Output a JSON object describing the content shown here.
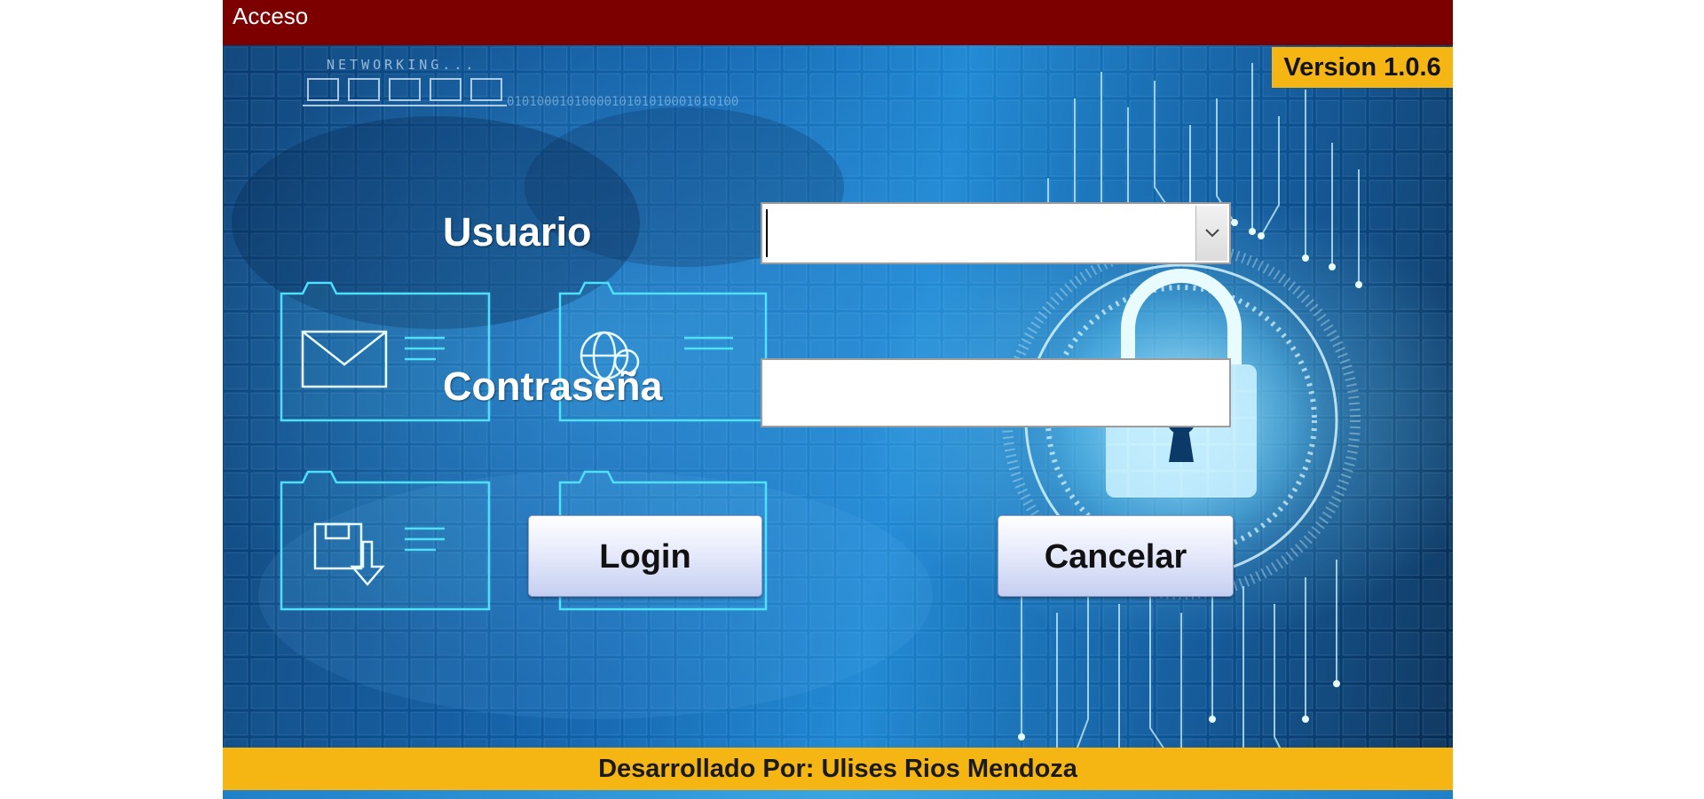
{
  "window": {
    "title": "Acceso"
  },
  "background": {
    "networking_text": "NETWORKING...",
    "binary_text": "0101000101000010101010001010100"
  },
  "version": {
    "label": "Version 1.0.6"
  },
  "form": {
    "user_label": "Usuario",
    "user_value": "",
    "password_label": "Contraseña",
    "password_value": ""
  },
  "buttons": {
    "login_label": "Login",
    "cancel_label": "Cancelar"
  },
  "footer": {
    "credit": "Desarrollado Por: Ulises Rios Mendoza"
  },
  "colors": {
    "titlebar": "#7d0000",
    "accent_yellow": "#f5b614",
    "button_face": "#dfe5f9"
  },
  "icons": [
    "mail-folder-icon",
    "globe-folder-icon",
    "save-folder-icon",
    "empty-folder-icon",
    "padlock-icon",
    "dropdown-arrow-icon"
  ]
}
